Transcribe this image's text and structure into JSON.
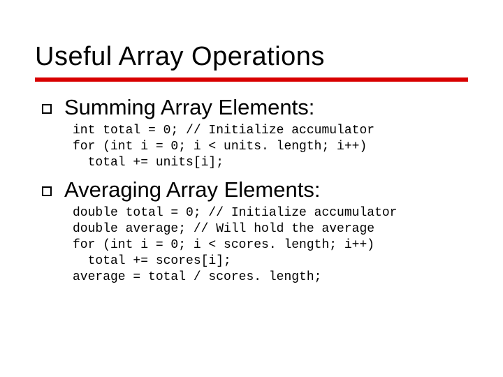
{
  "slide": {
    "title": "Useful Array Operations",
    "items": [
      {
        "heading": "Summing Array Elements:",
        "code": "int total = 0; // Initialize accumulator\nfor (int i = 0; i < units. length; i++)\n  total += units[i];"
      },
      {
        "heading": "Averaging Array Elements:",
        "code": "double total = 0; // Initialize accumulator\ndouble average; // Will hold the average\nfor (int i = 0; i < scores. length; i++)\n  total += scores[i];\naverage = total / scores. length;"
      }
    ]
  }
}
